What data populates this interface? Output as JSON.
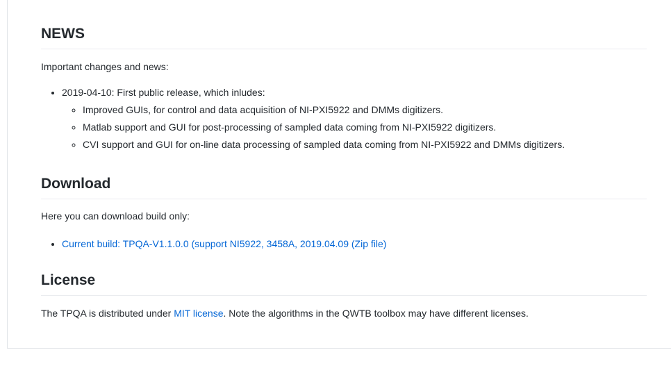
{
  "news": {
    "heading": "NEWS",
    "intro": "Important changes and news:",
    "release": {
      "label": "2019-04-10: First public release, which inludes:",
      "items": [
        "Improved GUIs, for control and data acquisition of NI-PXI5922 and DMMs digitizers.",
        "Matlab support and GUI for post-processing of sampled data coming from NI-PXI5922 digitizers.",
        "CVI support and GUI for on-line data processing of sampled data coming from NI-PXI5922 and DMMs digitizers."
      ]
    }
  },
  "download": {
    "heading": "Download",
    "intro": "Here you can download build only:",
    "link_text": "Current build: TPQA-V1.1.0.0 (support NI5922, 3458A, 2019.04.09 (Zip file)"
  },
  "license": {
    "heading": "License",
    "text_before": "The TPQA is distributed under ",
    "link_text": "MIT license",
    "text_after": ". Note the algorithms in the QWTB toolbox may have different licenses."
  },
  "colors": {
    "link": "#0366d6",
    "text": "#24292e",
    "divider": "#eaecef"
  }
}
